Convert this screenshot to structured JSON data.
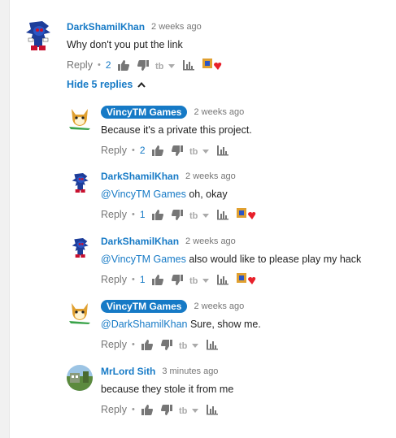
{
  "colors": {
    "link": "#167ac6",
    "muted": "#767676",
    "owner_badge": "#167ac6",
    "heart": "#e8202a"
  },
  "labels": {
    "reply": "Reply",
    "hide_replies": "Hide 5 replies"
  },
  "comments": [
    {
      "author": "DarkShamilKhan",
      "owner": false,
      "time": "2 weeks ago",
      "mention": "",
      "text": "Why don't you put the link",
      "likes": "2",
      "avatar": "sonic-exe-avatar",
      "hearted": true
    },
    {
      "author": "VincyTM Games",
      "owner": true,
      "time": "2 weeks ago",
      "mention": "",
      "text": "Because it's a private this project.",
      "likes": "2",
      "avatar": "fox-avatar",
      "hearted": false
    },
    {
      "author": "DarkShamilKhan",
      "owner": false,
      "time": "2 weeks ago",
      "mention": "@VincyTM Games",
      "text": " oh, okay",
      "likes": "1",
      "avatar": "sonic-exe-avatar",
      "hearted": true
    },
    {
      "author": "DarkShamilKhan",
      "owner": false,
      "time": "2 weeks ago",
      "mention": "@VincyTM Games",
      "text": " also would like to please play my hack",
      "likes": "1",
      "avatar": "sonic-exe-avatar",
      "hearted": true
    },
    {
      "author": "VincyTM Games",
      "owner": true,
      "time": "2 weeks ago",
      "mention": "@DarkShamilKhan",
      "text": " Sure, show me.",
      "likes": "",
      "avatar": "fox-avatar",
      "hearted": false
    },
    {
      "author": "MrLord Sith",
      "owner": false,
      "time": "3 minutes ago",
      "mention": "",
      "text": "because they stole it from me",
      "likes": "",
      "avatar": "landscape-avatar",
      "hearted": false
    }
  ]
}
